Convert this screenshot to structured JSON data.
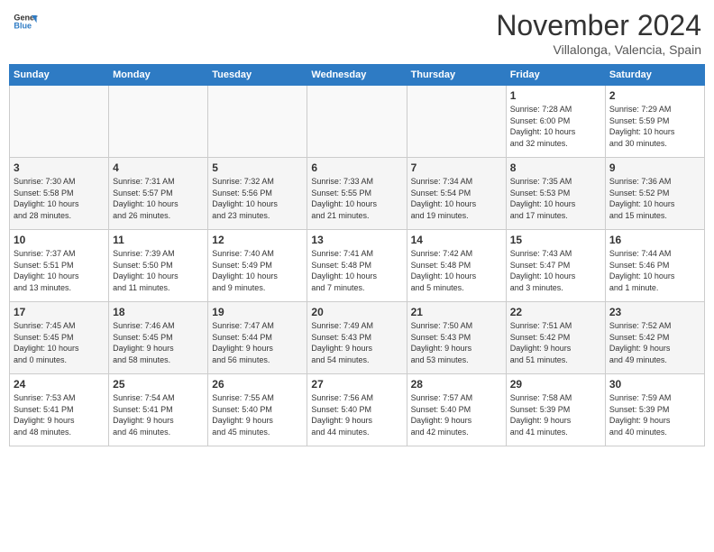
{
  "header": {
    "logo_line1": "General",
    "logo_line2": "Blue",
    "month": "November 2024",
    "location": "Villalonga, Valencia, Spain"
  },
  "days_of_week": [
    "Sunday",
    "Monday",
    "Tuesday",
    "Wednesday",
    "Thursday",
    "Friday",
    "Saturday"
  ],
  "weeks": [
    [
      {
        "day": "",
        "info": ""
      },
      {
        "day": "",
        "info": ""
      },
      {
        "day": "",
        "info": ""
      },
      {
        "day": "",
        "info": ""
      },
      {
        "day": "",
        "info": ""
      },
      {
        "day": "1",
        "info": "Sunrise: 7:28 AM\nSunset: 6:00 PM\nDaylight: 10 hours\nand 32 minutes."
      },
      {
        "day": "2",
        "info": "Sunrise: 7:29 AM\nSunset: 5:59 PM\nDaylight: 10 hours\nand 30 minutes."
      }
    ],
    [
      {
        "day": "3",
        "info": "Sunrise: 7:30 AM\nSunset: 5:58 PM\nDaylight: 10 hours\nand 28 minutes."
      },
      {
        "day": "4",
        "info": "Sunrise: 7:31 AM\nSunset: 5:57 PM\nDaylight: 10 hours\nand 26 minutes."
      },
      {
        "day": "5",
        "info": "Sunrise: 7:32 AM\nSunset: 5:56 PM\nDaylight: 10 hours\nand 23 minutes."
      },
      {
        "day": "6",
        "info": "Sunrise: 7:33 AM\nSunset: 5:55 PM\nDaylight: 10 hours\nand 21 minutes."
      },
      {
        "day": "7",
        "info": "Sunrise: 7:34 AM\nSunset: 5:54 PM\nDaylight: 10 hours\nand 19 minutes."
      },
      {
        "day": "8",
        "info": "Sunrise: 7:35 AM\nSunset: 5:53 PM\nDaylight: 10 hours\nand 17 minutes."
      },
      {
        "day": "9",
        "info": "Sunrise: 7:36 AM\nSunset: 5:52 PM\nDaylight: 10 hours\nand 15 minutes."
      }
    ],
    [
      {
        "day": "10",
        "info": "Sunrise: 7:37 AM\nSunset: 5:51 PM\nDaylight: 10 hours\nand 13 minutes."
      },
      {
        "day": "11",
        "info": "Sunrise: 7:39 AM\nSunset: 5:50 PM\nDaylight: 10 hours\nand 11 minutes."
      },
      {
        "day": "12",
        "info": "Sunrise: 7:40 AM\nSunset: 5:49 PM\nDaylight: 10 hours\nand 9 minutes."
      },
      {
        "day": "13",
        "info": "Sunrise: 7:41 AM\nSunset: 5:48 PM\nDaylight: 10 hours\nand 7 minutes."
      },
      {
        "day": "14",
        "info": "Sunrise: 7:42 AM\nSunset: 5:48 PM\nDaylight: 10 hours\nand 5 minutes."
      },
      {
        "day": "15",
        "info": "Sunrise: 7:43 AM\nSunset: 5:47 PM\nDaylight: 10 hours\nand 3 minutes."
      },
      {
        "day": "16",
        "info": "Sunrise: 7:44 AM\nSunset: 5:46 PM\nDaylight: 10 hours\nand 1 minute."
      }
    ],
    [
      {
        "day": "17",
        "info": "Sunrise: 7:45 AM\nSunset: 5:45 PM\nDaylight: 10 hours\nand 0 minutes."
      },
      {
        "day": "18",
        "info": "Sunrise: 7:46 AM\nSunset: 5:45 PM\nDaylight: 9 hours\nand 58 minutes."
      },
      {
        "day": "19",
        "info": "Sunrise: 7:47 AM\nSunset: 5:44 PM\nDaylight: 9 hours\nand 56 minutes."
      },
      {
        "day": "20",
        "info": "Sunrise: 7:49 AM\nSunset: 5:43 PM\nDaylight: 9 hours\nand 54 minutes."
      },
      {
        "day": "21",
        "info": "Sunrise: 7:50 AM\nSunset: 5:43 PM\nDaylight: 9 hours\nand 53 minutes."
      },
      {
        "day": "22",
        "info": "Sunrise: 7:51 AM\nSunset: 5:42 PM\nDaylight: 9 hours\nand 51 minutes."
      },
      {
        "day": "23",
        "info": "Sunrise: 7:52 AM\nSunset: 5:42 PM\nDaylight: 9 hours\nand 49 minutes."
      }
    ],
    [
      {
        "day": "24",
        "info": "Sunrise: 7:53 AM\nSunset: 5:41 PM\nDaylight: 9 hours\nand 48 minutes."
      },
      {
        "day": "25",
        "info": "Sunrise: 7:54 AM\nSunset: 5:41 PM\nDaylight: 9 hours\nand 46 minutes."
      },
      {
        "day": "26",
        "info": "Sunrise: 7:55 AM\nSunset: 5:40 PM\nDaylight: 9 hours\nand 45 minutes."
      },
      {
        "day": "27",
        "info": "Sunrise: 7:56 AM\nSunset: 5:40 PM\nDaylight: 9 hours\nand 44 minutes."
      },
      {
        "day": "28",
        "info": "Sunrise: 7:57 AM\nSunset: 5:40 PM\nDaylight: 9 hours\nand 42 minutes."
      },
      {
        "day": "29",
        "info": "Sunrise: 7:58 AM\nSunset: 5:39 PM\nDaylight: 9 hours\nand 41 minutes."
      },
      {
        "day": "30",
        "info": "Sunrise: 7:59 AM\nSunset: 5:39 PM\nDaylight: 9 hours\nand 40 minutes."
      }
    ]
  ]
}
